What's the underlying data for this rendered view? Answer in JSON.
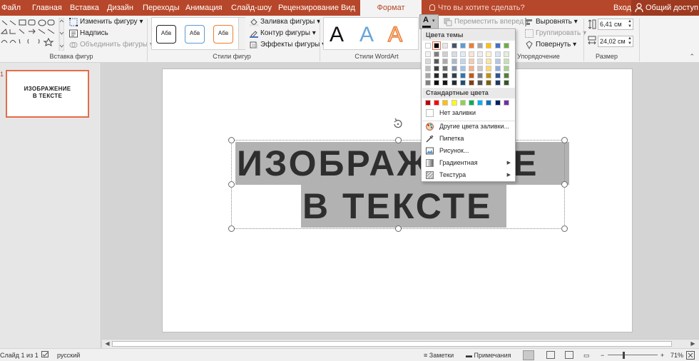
{
  "tabs": [
    {
      "label": "Файл"
    },
    {
      "label": "Главная"
    },
    {
      "label": "Вставка"
    },
    {
      "label": "Дизайн"
    },
    {
      "label": "Переходы"
    },
    {
      "label": "Анимация"
    },
    {
      "label": "Слайд-шоу"
    },
    {
      "label": "Рецензирование"
    },
    {
      "label": "Вид"
    },
    {
      "label": "Формат"
    }
  ],
  "tell_me": "Что вы хотите сделать?",
  "login": "Вход",
  "share": "Общий доступ",
  "ribbon": {
    "insert_shapes": {
      "label": "Вставка фигур",
      "edit_shape": "Изменить фигуру",
      "text_box": "Надпись",
      "merge_shapes": "Объединить фигуры"
    },
    "shape_styles": {
      "label": "Стили фигур",
      "samples": [
        "Абв",
        "Абв",
        "Абв"
      ],
      "fill": "Заливка фигуры",
      "outline": "Контур фигуры",
      "effects": "Эффекты фигуры"
    },
    "wordart": {
      "label": "Стили WordArt",
      "samples": [
        "A",
        "A",
        "A"
      ]
    },
    "arrange": {
      "label": "Упорядочение",
      "bring_forward": "Переместить вперед",
      "group": "Группировать",
      "align": "Выровнять",
      "rotate": "Повернуть"
    },
    "size": {
      "label": "Размер",
      "height": "6,41 см",
      "width": "24,02 см"
    }
  },
  "thumbnail": {
    "number": "1",
    "line1": "ИЗОБРАЖЕНИЕ",
    "line2": "В ТЕКСТЕ"
  },
  "slide": {
    "line1": "ИЗОБРАЖЕНИЕ",
    "line2": "В ТЕКСТЕ"
  },
  "fill_menu": {
    "theme_colors_header": "Цвета темы",
    "standard_colors_header": "Стандартные цвета",
    "theme_top_row": [
      "#ffffff",
      "#000000",
      "#e7e6e6",
      "#44546a",
      "#5b9bd5",
      "#ed7d31",
      "#a5a5a5",
      "#ffc000",
      "#4472c4",
      "#70ad47"
    ],
    "theme_shades": [
      [
        "#f2f2f2",
        "#7f7f7f",
        "#d0cece",
        "#d6dce4",
        "#deebf6",
        "#fbe5d5",
        "#ededed",
        "#fff2cc",
        "#dae3f3",
        "#e2efd9"
      ],
      [
        "#d8d8d8",
        "#595959",
        "#aeaaaa",
        "#adb9ca",
        "#bdd7ee",
        "#f7cbac",
        "#dbdbdb",
        "#fee599",
        "#b4c6e7",
        "#c5e0b3"
      ],
      [
        "#bfbfbf",
        "#3f3f3f",
        "#757070",
        "#8496b0",
        "#9cc3e5",
        "#f4b183",
        "#c9c9c9",
        "#ffd965",
        "#8eaadb",
        "#a8d08d"
      ],
      [
        "#a5a5a5",
        "#262626",
        "#3a3838",
        "#323f4f",
        "#2e75b5",
        "#c55a11",
        "#7b7b7b",
        "#bf9000",
        "#2f5496",
        "#538135"
      ],
      [
        "#7f7f7f",
        "#0c0c0c",
        "#171616",
        "#222a35",
        "#1e4e79",
        "#833c0b",
        "#525252",
        "#7f6000",
        "#1f3864",
        "#375623"
      ]
    ],
    "standard_colors": [
      "#c00000",
      "#ff0000",
      "#ffc000",
      "#ffff00",
      "#92d050",
      "#00b050",
      "#00b0f0",
      "#0070c0",
      "#002060",
      "#7030a0"
    ],
    "no_fill": "Нет заливки",
    "more_colors": "Другие цвета заливки...",
    "eyedropper": "Пипетка",
    "picture": "Рисунок...",
    "gradient": "Градиентная",
    "texture": "Текстура"
  },
  "status": {
    "slide_of": "Слайд 1 из 1",
    "language": "русский",
    "notes": "Заметки",
    "comments": "Примечания",
    "zoom": "71%"
  },
  "colors": {
    "accent": "#b7472a",
    "highlight_gray": "#b2b2b2",
    "text_dark": "#2e2e2e"
  }
}
